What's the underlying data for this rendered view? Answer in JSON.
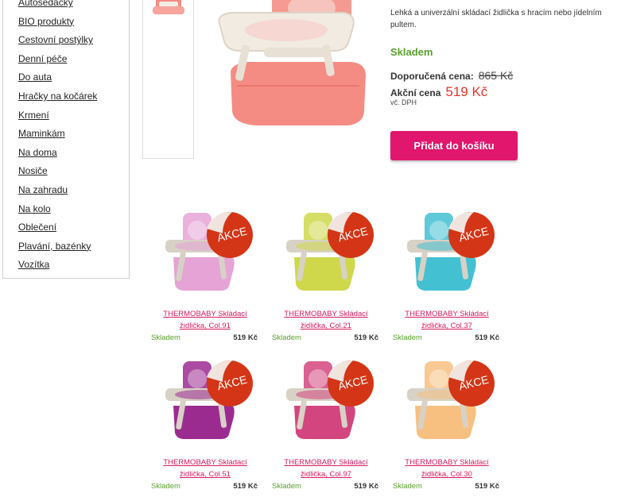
{
  "sidebar": {
    "items": [
      {
        "label": "Autosedačky"
      },
      {
        "label": "BIO produkty"
      },
      {
        "label": "Cestovní postýlky"
      },
      {
        "label": "Denní péče"
      },
      {
        "label": "Do auta"
      },
      {
        "label": "Hračky na kočárek"
      },
      {
        "label": "Krmení"
      },
      {
        "label": "Maminkám"
      },
      {
        "label": "Na doma"
      },
      {
        "label": "Nosiče"
      },
      {
        "label": "Na zahradu"
      },
      {
        "label": "Na kolo"
      },
      {
        "label": "Oblečení"
      },
      {
        "label": "Plavání, bazénky"
      },
      {
        "label": "Vozítka"
      }
    ]
  },
  "product": {
    "description": "Lehká a univerzální skládací židlička s hracím nebo jídelním pultem.",
    "stock": "Skladem",
    "recommended_label": "Doporučená cena:",
    "recommended_price": "865 Kč",
    "sale_label": "Akční cena",
    "sale_price": "519 Kč",
    "vat_note": "vč. DPH",
    "add_to_cart": "Přidat do košíku",
    "color": "#f38b84"
  },
  "sale_badge": "AKCE",
  "related": [
    {
      "title": "THERMOBABY Skládací židlička, Col.91",
      "stock": "Skladem",
      "price": "519 Kč",
      "color": "#e6a3d6"
    },
    {
      "title": "THERMOBABY Skládací židlička, Col.21",
      "stock": "Skladem",
      "price": "519 Kč",
      "color": "#cfd84a"
    },
    {
      "title": "THERMOBABY Skládací židlička, Col.37",
      "stock": "Skladem",
      "price": "519 Kč",
      "color": "#43c0d2"
    },
    {
      "title": "THERMOBABY Skládací židlička, Col.51",
      "stock": "Skladem",
      "price": "519 Kč",
      "color": "#9c2b90"
    },
    {
      "title": "THERMOBABY Skládací židlička, Col.97",
      "stock": "Skladem",
      "price": "519 Kč",
      "color": "#d3457e"
    },
    {
      "title": "THERMOBABY Skládací židlička, Col.30",
      "stock": "Skladem",
      "price": "519 Kč",
      "color": "#f7c080"
    }
  ]
}
